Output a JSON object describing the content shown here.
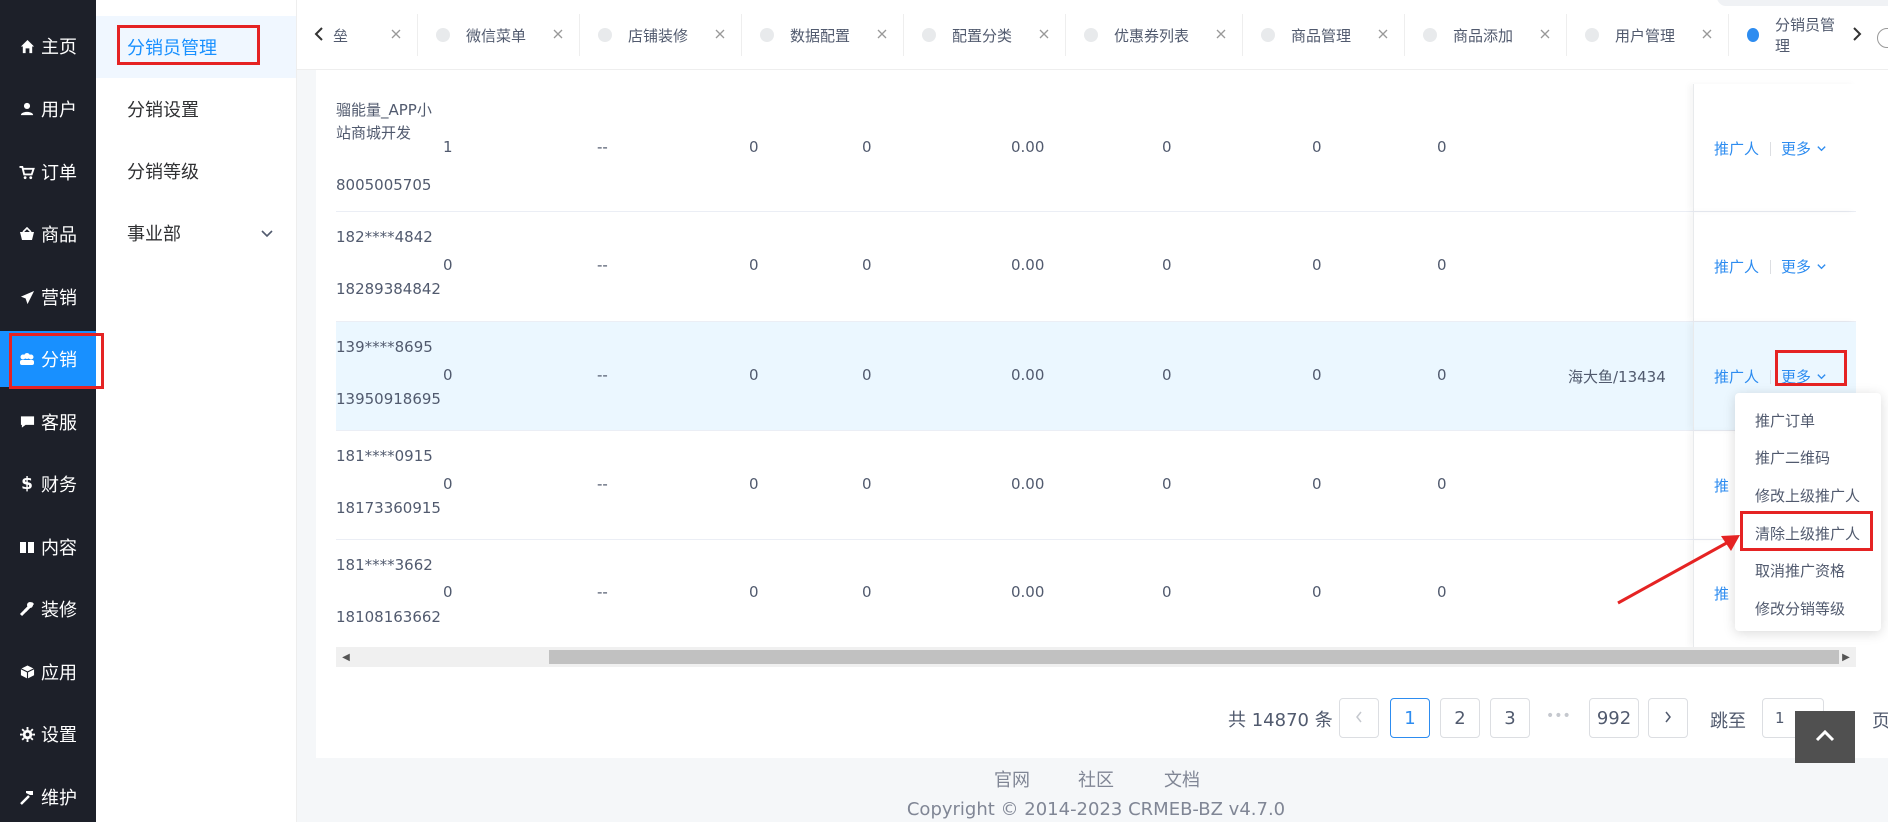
{
  "main_menu": [
    {
      "label": "主页",
      "icon": "home-icon"
    },
    {
      "label": "用户",
      "icon": "user-icon"
    },
    {
      "label": "订单",
      "icon": "cart-icon"
    },
    {
      "label": "商品",
      "icon": "basket-icon"
    },
    {
      "label": "营销",
      "icon": "send-icon"
    },
    {
      "label": "分销",
      "icon": "group-icon",
      "active": true
    },
    {
      "label": "客服",
      "icon": "chat-icon"
    },
    {
      "label": "财务",
      "icon": "dollar-icon"
    },
    {
      "label": "内容",
      "icon": "book-icon"
    },
    {
      "label": "装修",
      "icon": "tools-icon"
    },
    {
      "label": "应用",
      "icon": "cube-icon"
    },
    {
      "label": "设置",
      "icon": "gear-icon"
    },
    {
      "label": "维护",
      "icon": "hammer-icon"
    }
  ],
  "sub_menu": [
    {
      "label": "分销员管理",
      "active": true
    },
    {
      "label": "分销设置"
    },
    {
      "label": "分销等级"
    },
    {
      "label": "事业部",
      "expandable": true
    }
  ],
  "tabs": [
    {
      "label": "垒"
    },
    {
      "label": "微信菜单"
    },
    {
      "label": "店铺装修"
    },
    {
      "label": "数据配置"
    },
    {
      "label": "配置分类"
    },
    {
      "label": "优惠券列表"
    },
    {
      "label": "商品管理"
    },
    {
      "label": "商品添加"
    },
    {
      "label": "用户管理"
    },
    {
      "label": "分销员管理",
      "active": true
    }
  ],
  "table": {
    "rows": [
      {
        "user_line1": "骝能量_APP小",
        "user_line2": "站商城开发",
        "user_line3": "8005005705",
        "c1": "1",
        "c2": "--",
        "c3": "0",
        "c4": "0",
        "c5": "0.00",
        "c6": "0",
        "c7": "0",
        "c8": "0",
        "c9": ""
      },
      {
        "user_line1": "182****4842",
        "user_line2": "",
        "user_line3": "18289384842",
        "c1": "0",
        "c2": "--",
        "c3": "0",
        "c4": "0",
        "c5": "0.00",
        "c6": "0",
        "c7": "0",
        "c8": "0",
        "c9": ""
      },
      {
        "user_line1": "139****8695",
        "user_line2": "",
        "user_line3": "13950918695",
        "c1": "0",
        "c2": "--",
        "c3": "0",
        "c4": "0",
        "c5": "0.00",
        "c6": "0",
        "c7": "0",
        "c8": "0",
        "c9": "海大鱼/13434"
      },
      {
        "user_line1": "181****0915",
        "user_line2": "",
        "user_line3": "18173360915",
        "c1": "0",
        "c2": "--",
        "c3": "0",
        "c4": "0",
        "c5": "0.00",
        "c6": "0",
        "c7": "0",
        "c8": "0",
        "c9": ""
      },
      {
        "user_line1": "181****3662",
        "user_line2": "",
        "user_line3": "18108163662",
        "c1": "0",
        "c2": "--",
        "c3": "0",
        "c4": "0",
        "c5": "0.00",
        "c6": "0",
        "c7": "0",
        "c8": "0",
        "c9": ""
      }
    ],
    "action_promoter": "推广人",
    "action_more": "更多",
    "action_promoter_clipped": "推"
  },
  "dropdown": {
    "items": [
      "推广订单",
      "推广二维码",
      "修改上级推广人",
      "清除上级推广人",
      "取消推广资格",
      "修改分销等级"
    ]
  },
  "pagination": {
    "total": "共 14870 条",
    "pages": [
      "1",
      "2",
      "3"
    ],
    "ellipsis": "•••",
    "last_page": "992",
    "current": "1",
    "jump_label": "跳至",
    "jump_value": "1",
    "page_suffix": "页"
  },
  "footer": {
    "links": [
      "官网",
      "社区",
      "文档"
    ],
    "copyright": "Copyright © 2014-2023 CRMEB-BZ v4.7.0"
  },
  "colors": {
    "accent": "#1890ff",
    "menu_bg": "#1d2029",
    "annotation_red": "#e52323"
  }
}
